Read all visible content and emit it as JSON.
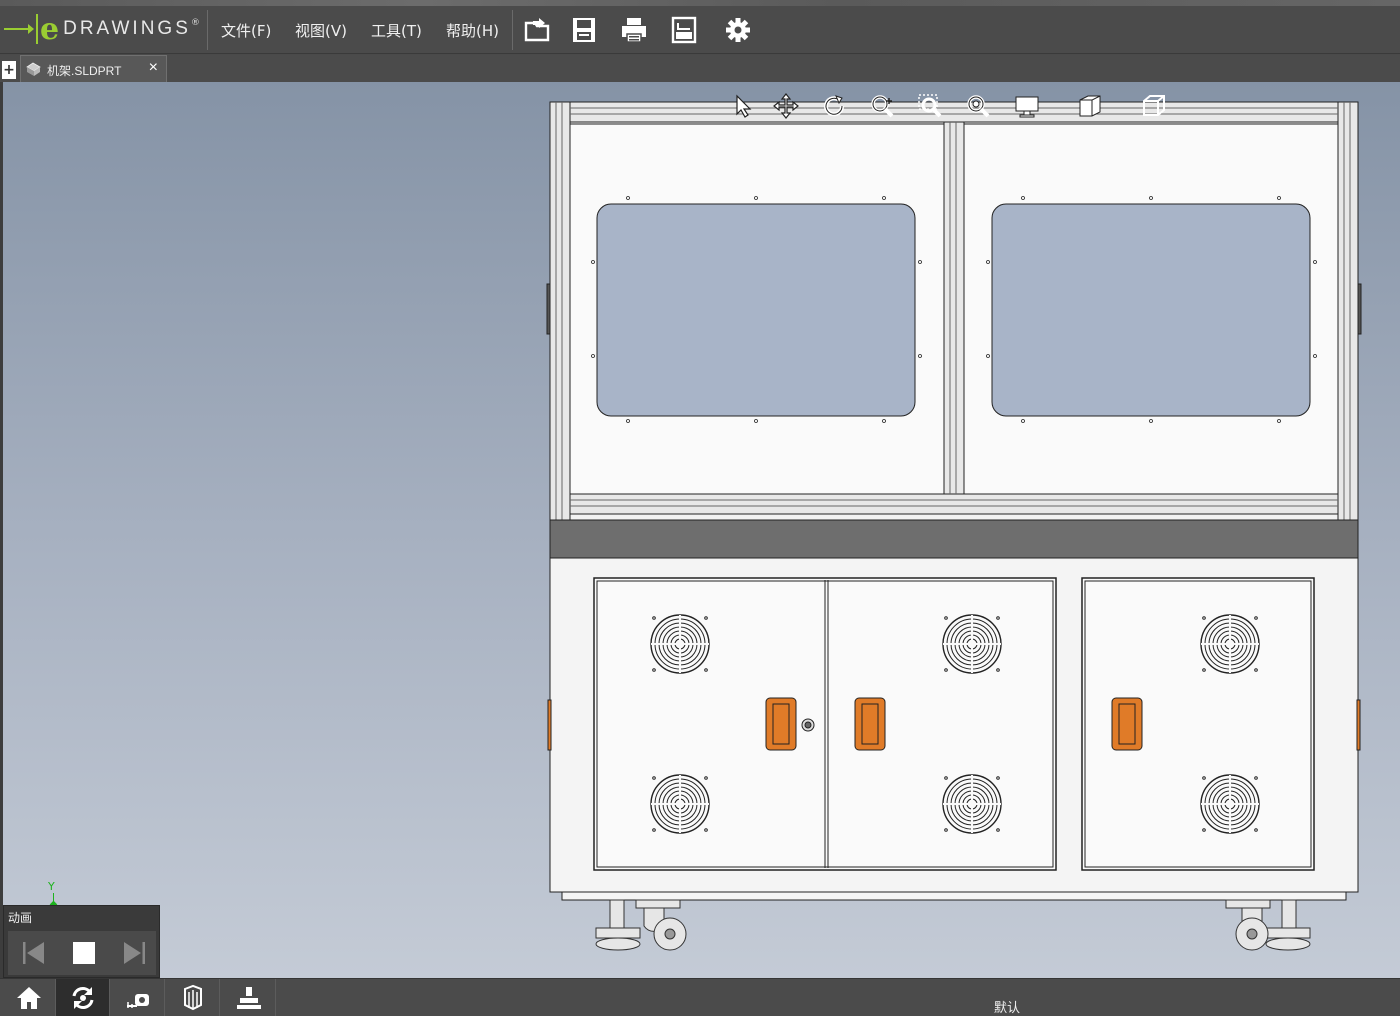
{
  "app": {
    "logo_word": "DRAWINGS",
    "logo_letter": "e",
    "logo_mark": "®"
  },
  "menu": [
    {
      "label": "文件(F)"
    },
    {
      "label": "视图(V)"
    },
    {
      "label": "工具(T)"
    },
    {
      "label": "帮助(H)"
    }
  ],
  "toolbar_icons": [
    "open-icon",
    "save-icon",
    "print-icon",
    "publish-icon",
    "settings-icon"
  ],
  "tab": {
    "new_tab_symbol": "+",
    "document_label": "机架.SLDPRT",
    "close_symbol": "×"
  },
  "view_tools": [
    "select-icon",
    "pan-icon",
    "rotate-icon",
    "zoom-icon",
    "zoom-to-area-icon",
    "zoom-to-fit-icon",
    "display-style-icon",
    "section-icon",
    "standard-views-icon"
  ],
  "triad": {
    "axis_label": "Y"
  },
  "animation": {
    "title": "动画",
    "controls": [
      "skip-back-icon",
      "stop-icon",
      "skip-forward-icon"
    ]
  },
  "bottom_tools": [
    "home-icon",
    "reload-icon",
    "measure-icon",
    "explode-icon",
    "stamp-icon"
  ],
  "status": {
    "configuration": "默认"
  },
  "colors": {
    "accent": "#9acd32",
    "handle": "#e07b28",
    "glass": "#a8b4c8",
    "chrome": "#4b4b4b"
  }
}
